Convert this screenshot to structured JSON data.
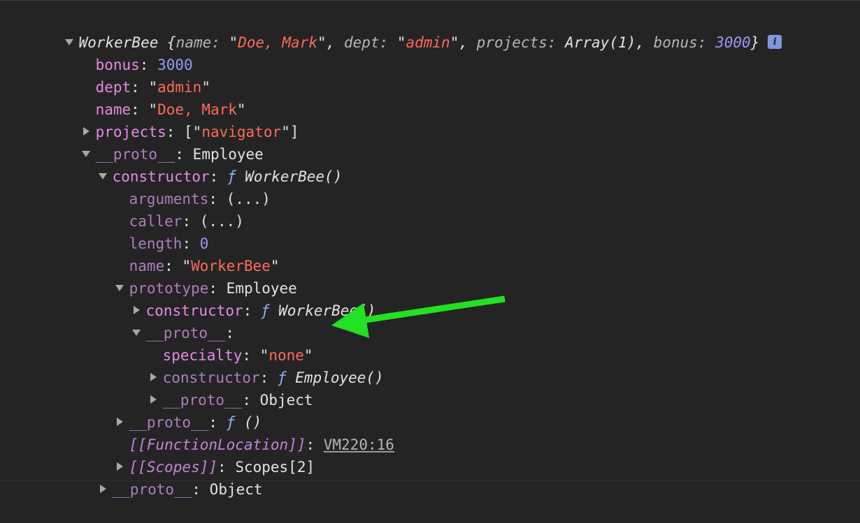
{
  "root": {
    "class_name": "WorkerBee",
    "preview_open": " {",
    "preview": [
      {
        "key": "name",
        "value": "Doe, Mark",
        "kind": "string"
      },
      {
        "key": "dept",
        "value": "admin",
        "kind": "string"
      },
      {
        "key": "projects",
        "value": "Array(1)",
        "kind": "plain"
      },
      {
        "key": "bonus",
        "value": "3000",
        "kind": "number"
      }
    ],
    "preview_close": "}",
    "info_badge": "i"
  },
  "rows": [
    {
      "key": "bonus",
      "value": "3000"
    },
    {
      "key": "dept",
      "value": "admin"
    },
    {
      "key": "name",
      "value": "Doe, Mark"
    },
    {
      "key": "projects",
      "value": "navigator"
    },
    {
      "key": "__proto__",
      "value": "Employee"
    },
    {
      "key": "constructor",
      "f": "ƒ",
      "value": "WorkerBee()"
    },
    {
      "key": "arguments",
      "value": "(...)"
    },
    {
      "key": "caller",
      "value": "(...)"
    },
    {
      "key": "length",
      "value": "0"
    },
    {
      "key": "name",
      "value": "WorkerBee"
    },
    {
      "key": "prototype",
      "value": "Employee"
    },
    {
      "key": "constructor",
      "f": "ƒ",
      "value": "WorkerBee()"
    },
    {
      "key": "__proto__",
      "value": ""
    },
    {
      "key": "specialty",
      "value": "none"
    },
    {
      "key": "constructor",
      "f": "ƒ",
      "value": "Employee()"
    },
    {
      "key": "__proto__",
      "value": "Object"
    },
    {
      "key": "__proto__",
      "f": "ƒ",
      "value": "()"
    },
    {
      "key": "[[FunctionLocation]]",
      "value": "VM220:16"
    },
    {
      "key": "[[Scopes]]",
      "value": "Scopes[2]"
    },
    {
      "key": "__proto__",
      "value": "Object"
    }
  ],
  "colors": {
    "background": "#242424",
    "key": "#e58ae7",
    "string": "#ff6b5a",
    "number": "#9a9af8",
    "function": "#8ab4f8",
    "annotation_arrow": "#22e022"
  }
}
